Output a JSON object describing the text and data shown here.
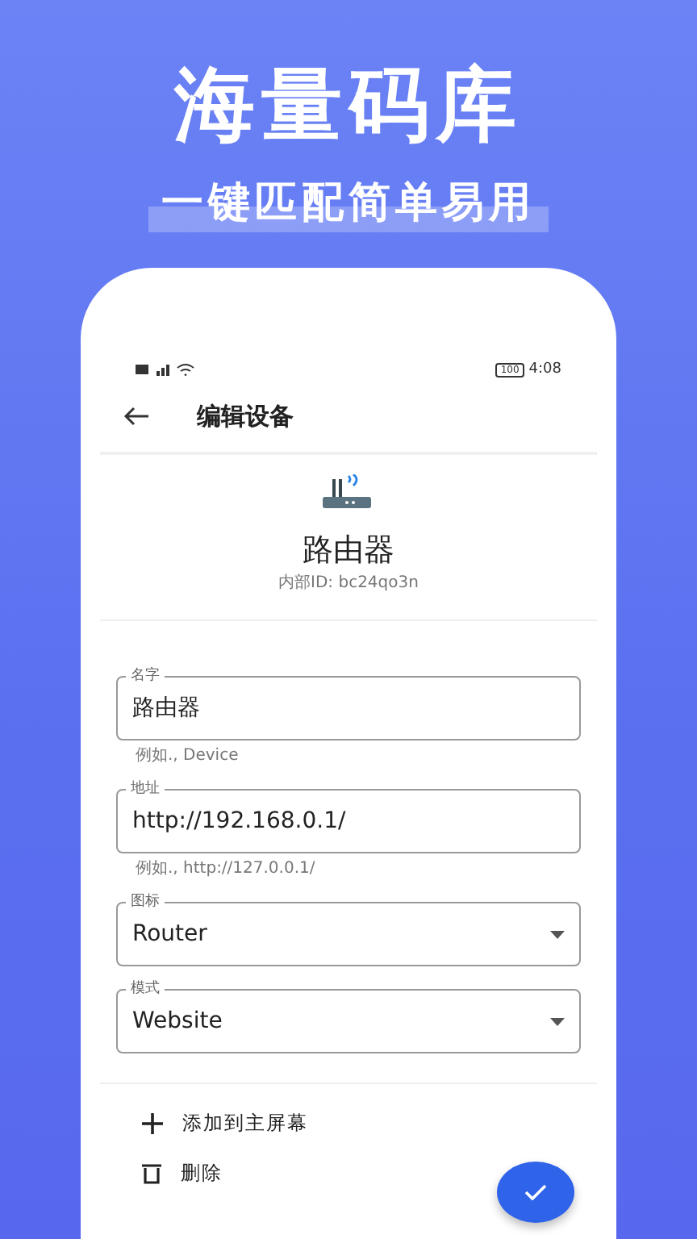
{
  "headline": "海量码库",
  "subheadline": "一键匹配简单易用",
  "status_bar": {
    "battery": "100",
    "time": "4:08"
  },
  "app_bar": {
    "title": "编辑设备"
  },
  "device": {
    "name": "路由器",
    "internal_id": "内部ID: bc24qo3n"
  },
  "fields": [
    {
      "kind": "text",
      "label": "名字",
      "value": "路由器",
      "helper": "例如., Device"
    },
    {
      "kind": "text",
      "label": "地址",
      "value": "http://192.168.0.1/",
      "helper": "例如., http://127.0.0.1/"
    },
    {
      "kind": "dropdown",
      "label": "图标",
      "value": "Router"
    },
    {
      "kind": "dropdown",
      "label": "模式",
      "value": "Website"
    }
  ],
  "actions": [
    {
      "kind": "add",
      "label": "添加到主屏幕"
    },
    {
      "kind": "delete",
      "label": "删除"
    }
  ]
}
